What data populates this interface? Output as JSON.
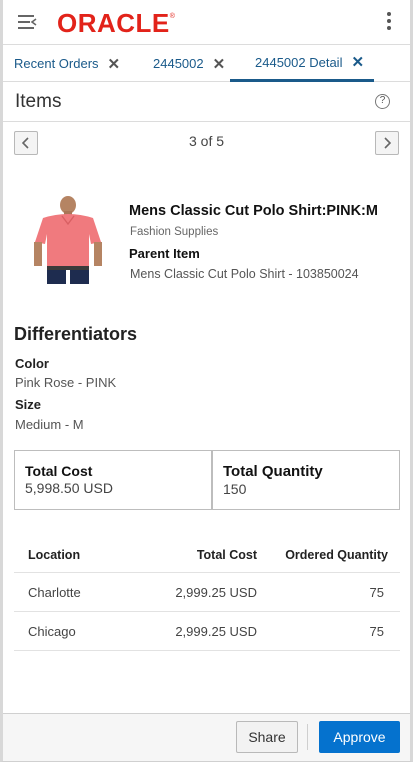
{
  "app": {
    "brand": "ORACLE",
    "brand_mark": "®"
  },
  "tabs": [
    {
      "label": "Recent Orders",
      "close": "✕"
    },
    {
      "label": "2445002",
      "close": "✕"
    },
    {
      "label": "2445002 Detail",
      "close": "✕",
      "active": true
    }
  ],
  "items_header": {
    "title": "Items",
    "help": "?"
  },
  "pager": {
    "text": "3 of 5",
    "prev": "<",
    "next": ">"
  },
  "product": {
    "name": "Mens Classic Cut Polo Shirt:PINK:M",
    "department": "Fashion Supplies",
    "parent_label": "Parent Item",
    "parent_value": "Mens Classic Cut Polo Shirt - 103850024"
  },
  "differentiators": {
    "title": "Differentiators",
    "color_label": "Color",
    "color_value": "Pink Rose - PINK",
    "size_label": "Size",
    "size_value": "Medium - M"
  },
  "totals": {
    "cost_label": "Total Cost",
    "cost_value": "5,998.50 USD",
    "qty_label": "Total Quantity",
    "qty_value": "150"
  },
  "table": {
    "headers": [
      "Location",
      "Total Cost",
      "Ordered Quantity"
    ],
    "rows": [
      [
        "Charlotte",
        "2,999.25 USD",
        "75"
      ],
      [
        "Chicago",
        "2,999.25 USD",
        "75"
      ]
    ]
  },
  "footer": {
    "share": "Share",
    "approve": "Approve"
  },
  "colors": {
    "brand": "#e2231a",
    "accent": "#0572ce",
    "link": "#1a5a8a"
  }
}
